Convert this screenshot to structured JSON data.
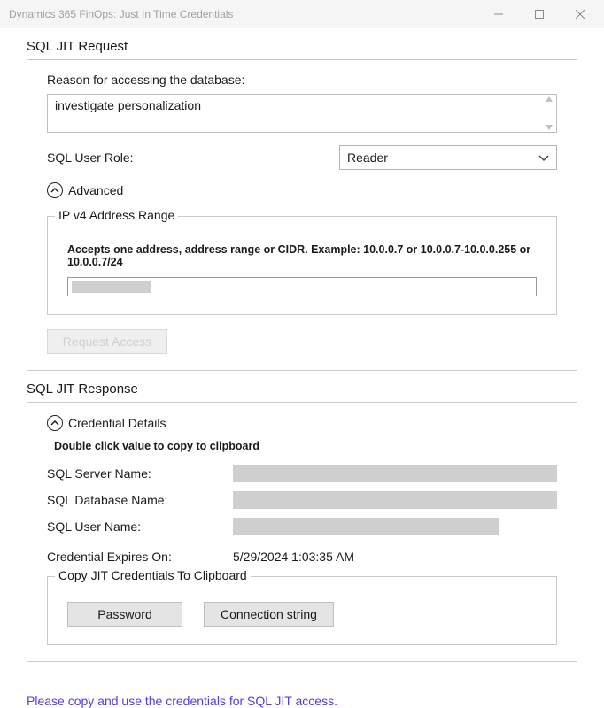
{
  "window": {
    "title": "Dynamics 365 FinOps: Just In Time Credentials"
  },
  "request": {
    "section_title": "SQL JIT Request",
    "reason_label": "Reason for accessing the database:",
    "reason_value": "investigate personalization",
    "role_label": "SQL User Role:",
    "role_selected": "Reader",
    "advanced_label": "Advanced",
    "ip_legend": "IP v4 Address Range",
    "ip_hint": "Accepts one address, address range or CIDR. Example: 10.0.0.7 or 10.0.0.7-10.0.0.255 or 10.0.0.7/24",
    "request_button": "Request Access"
  },
  "response": {
    "section_title": "SQL JIT Response",
    "details_label": "Credential Details",
    "copy_hint": "Double click value to copy to clipboard",
    "server_label": "SQL Server Name:",
    "db_label": "SQL Database Name:",
    "user_label": "SQL User Name:",
    "expires_label": "Credential Expires On:",
    "expires_value": "5/29/2024 1:03:35 AM",
    "clip_legend": "Copy JIT Credentials To Clipboard",
    "password_button": "Password",
    "conn_button": "Connection string"
  },
  "footer": {
    "note": "Please copy and use the credentials for SQL JIT access."
  }
}
